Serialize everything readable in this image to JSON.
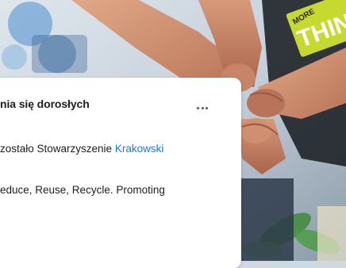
{
  "post": {
    "title": "nia się dorosłych",
    "more_label": "...",
    "line1_text": "zostało Stowarzyszenie ",
    "line1_link": "Krakowski",
    "line2_text": "educe, Reuse, Recycle. Promoting"
  },
  "photo": {
    "sign_text": "THIN",
    "sign_small_text": "MORE"
  }
}
